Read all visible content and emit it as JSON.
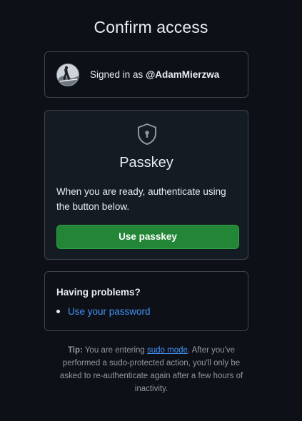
{
  "page": {
    "title": "Confirm access"
  },
  "account": {
    "signed_in_prefix": "Signed in as ",
    "username": "@AdamMierzwa"
  },
  "passkey": {
    "icon": "shield-lock-icon",
    "title": "Passkey",
    "description": "When you are ready, authenticate using the button below.",
    "button_label": "Use passkey"
  },
  "problems": {
    "title": "Having problems?",
    "items": [
      {
        "label": "Use your password"
      }
    ]
  },
  "tip": {
    "label": "Tip:",
    "text_before": " You are entering ",
    "link_text": "sudo mode",
    "text_after": ". After you've performed a sudo-protected action, you'll only be asked to re-authenticate again after a few hours of inactivity."
  },
  "colors": {
    "background": "#0d1117",
    "card_border": "#3d444d",
    "primary_button": "#238636",
    "link": "#4493f8",
    "muted_text": "#9198a1"
  }
}
